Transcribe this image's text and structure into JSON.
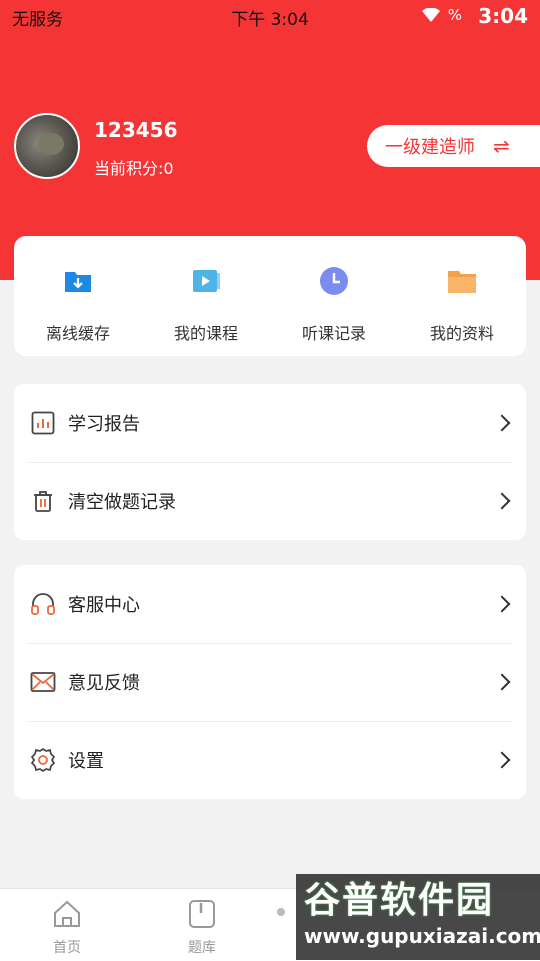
{
  "status_bar": {
    "left_text": "无服务",
    "center_time": "下午 3:04",
    "battery_text": "%",
    "right_time": "3:04"
  },
  "profile": {
    "username": "123456",
    "points": "当前积分:0",
    "role_label": "一级建造师",
    "swap_icon": "⇌"
  },
  "quick_actions": [
    {
      "label": "离线缓存",
      "icon": "download-folder-icon",
      "color": "#1e88e5"
    },
    {
      "label": "我的课程",
      "icon": "video-course-icon",
      "color": "#4fb3e8"
    },
    {
      "label": "听课记录",
      "icon": "clock-icon",
      "color": "#7b8cf0"
    },
    {
      "label": "我的资料",
      "icon": "folder-icon",
      "color": "#f5a04a"
    }
  ],
  "menu_group_1": [
    {
      "label": "学习报告",
      "icon": "report-chart-icon"
    },
    {
      "label": "清空做题记录",
      "icon": "trash-icon"
    }
  ],
  "menu_group_2": [
    {
      "label": "客服中心",
      "icon": "headphones-icon"
    },
    {
      "label": "意见反馈",
      "icon": "mail-icon"
    },
    {
      "label": "设置",
      "icon": "settings-gear-icon"
    }
  ],
  "tabbar": [
    {
      "label": "首页",
      "icon": "home-icon"
    },
    {
      "label": "题库",
      "icon": "question-bank-icon"
    }
  ],
  "watermark": {
    "title": "谷普软件园",
    "url": "www.gupuxiazai.com"
  },
  "colors": {
    "brand_red": "#f53535",
    "accent_orange": "#e8693a"
  }
}
